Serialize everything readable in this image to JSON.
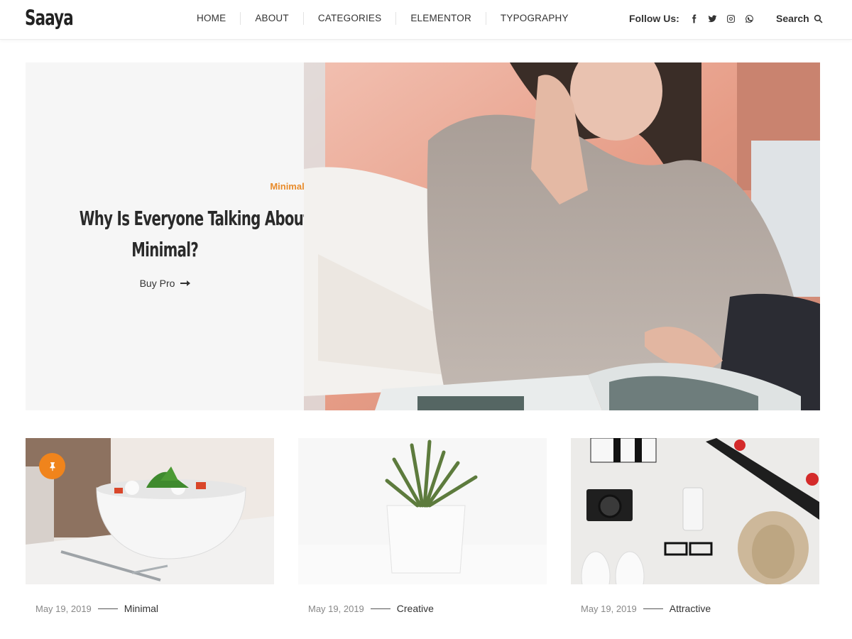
{
  "header": {
    "logo": "Saaya",
    "nav": [
      "HOME",
      "ABOUT",
      "CATEGORIES",
      "ELEMENTOR",
      "TYPOGRAPHY"
    ],
    "follow_label": "Follow Us:",
    "social_icons": [
      "facebook-icon",
      "twitter-icon",
      "instagram-icon",
      "whatsapp-icon"
    ],
    "search_label": "Search"
  },
  "hero": {
    "category": "Minimal Design",
    "title_line1": "Why Is Everyone Talking About",
    "title_line2": "Minimal?",
    "button_label": "Buy Pro",
    "image_alt": "Woman reading a magazine on a pink sofa"
  },
  "cards": [
    {
      "date": "May 19, 2019",
      "category": "Minimal",
      "image_alt": "Salad bowl with fork",
      "pinned": true
    },
    {
      "date": "May 19, 2019",
      "category": "Creative",
      "image_alt": "Succulent in white pot",
      "pinned": false
    },
    {
      "date": "May 19, 2019",
      "category": "Attractive",
      "image_alt": "Flat lay with camera, phone, glasses, hat, skateboard",
      "pinned": false
    }
  ],
  "colors": {
    "accent": "#e88b2b",
    "pin_badge": "#f0841c",
    "text_dark": "#2a2a2a",
    "hero_panel_bg": "#f6f6f6"
  }
}
